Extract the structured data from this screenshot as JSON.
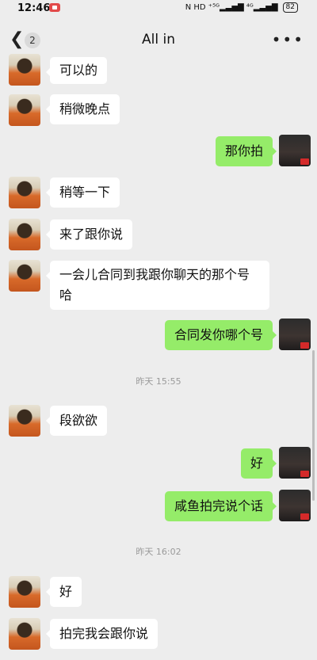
{
  "status": {
    "time": "12:46",
    "indicators": "N  HD  ⁺⁵ᴳ▂▃▅▇  ⁴ᴳ▂▃▅▇",
    "battery": "82"
  },
  "header": {
    "back_icon": "chevron-left",
    "unread_count": "2",
    "title": "All in",
    "more_icon": "more-dots"
  },
  "messages": [
    {
      "side": "left",
      "text": "可以的"
    },
    {
      "side": "left",
      "text": "稍微晚点"
    },
    {
      "side": "right",
      "text": "那你拍"
    },
    {
      "side": "left",
      "text": "稍等一下"
    },
    {
      "side": "left",
      "text": "来了跟你说"
    },
    {
      "side": "left",
      "text": "一会儿合同到我跟你聊天的那个号哈"
    },
    {
      "side": "right",
      "text": "合同发你哪个号"
    },
    {
      "side": "left",
      "text": "段欲欲"
    },
    {
      "side": "right",
      "text": "好"
    },
    {
      "side": "right",
      "text": "咸鱼拍完说个话"
    },
    {
      "side": "left",
      "text": "好"
    },
    {
      "side": "left",
      "text": "拍完我会跟你说"
    }
  ],
  "timestamps": [
    "昨天 15:55",
    "昨天 16:02"
  ],
  "colors": {
    "background": "#ededed",
    "sent_bubble": "#95ec69",
    "received_bubble": "#ffffff"
  }
}
